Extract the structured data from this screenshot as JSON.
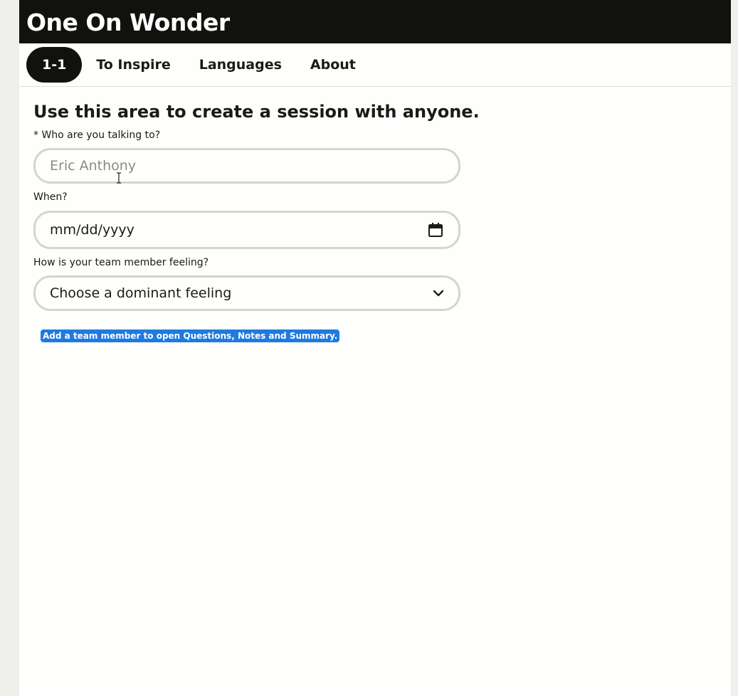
{
  "app": {
    "title": "One On Wonder"
  },
  "nav": {
    "tabs": [
      {
        "label": "1-1",
        "active": true
      },
      {
        "label": "To Inspire",
        "active": false
      },
      {
        "label": "Languages",
        "active": false
      },
      {
        "label": "About",
        "active": false
      }
    ]
  },
  "form": {
    "heading": "Use this area to create a session with anyone.",
    "who": {
      "label": "* Who are you talking to?",
      "placeholder": "Eric Anthony",
      "value": ""
    },
    "when": {
      "label": "When?",
      "value": "mm/dd/yyyy",
      "icon": "calendar-icon"
    },
    "feeling": {
      "label": "How is your team member feeling?",
      "selected": "Choose a dominant feeling",
      "icon": "chevron-down-icon"
    },
    "hint": "Add a team member to open Questions, Notes and Summary."
  },
  "colors": {
    "header_bg": "#11110e",
    "page_bg": "#fefefc",
    "hint_bg": "#1f7ae0",
    "field_border": "#d4d4d0"
  }
}
